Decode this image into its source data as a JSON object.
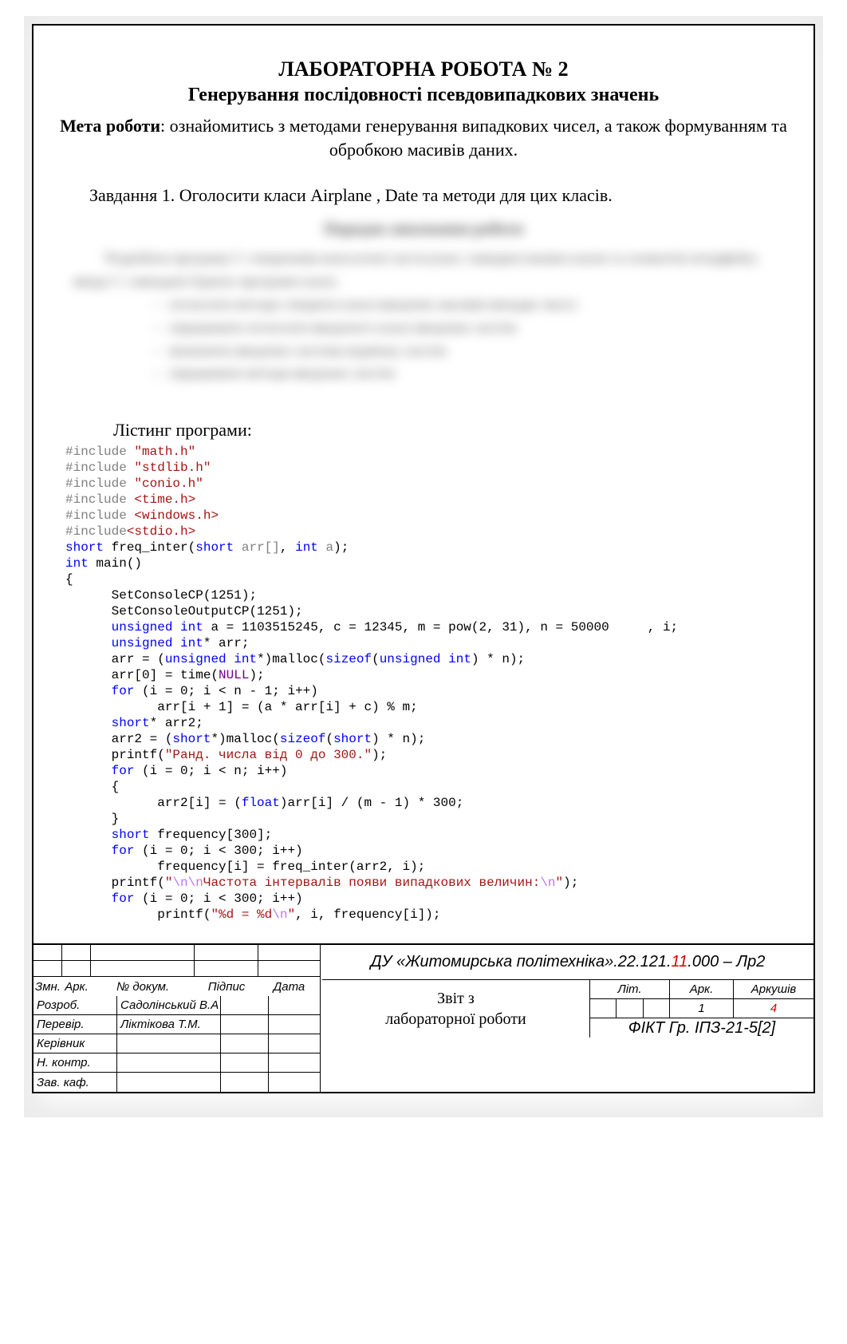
{
  "heading": {
    "title": "ЛАБОРАТОРНА РОБОТА № 2",
    "subtitle": "Генерування послідовності псевдовипадкових значень",
    "objective_label": "Мета роботи",
    "objective_text": ": ознайомитись з методами генерування випадкових чисел, а також формуванням та обробкою масивів даних."
  },
  "task1": "Завдання 1. Оголосити класи Airplane , Date та методи для цих класів.",
  "listing_label": "Лістинг програми:",
  "code": {
    "inc1": "\"math.h\"",
    "inc2": "\"stdlib.h\"",
    "inc3": "\"conio.h\"",
    "inc4": "<time.h>",
    "inc5": "<windows.h>",
    "inc6": "<stdio.h>",
    "fn_decl_name": "freq_inter",
    "setcp": "SetConsoleCP(1251);",
    "setocp": "SetConsoleOutputCP(1251);",
    "vars": "a = 1103515245, c = 12345, m = pow(2, 31), n = 50000     , i;",
    "arr0": "arr[0] = time(",
    "null": "NULL",
    "loop1": "(i = 0; i < n - 1; i++)",
    "loop1_body": "arr[i + 1] = (a * arr[i] + c) % m;",
    "arr2_decl": "* arr2;",
    "arr2_alloc": "arr2 = (",
    "printf1": "\"Ранд. числа від 0 до 300.\"",
    "loop2": "(i = 0; i < n; i++)",
    "loop2_body": "arr2[i] = (",
    "loop2_body2": ")arr[i] / (m - 1) * 300;",
    "freq_decl": " frequency[300];",
    "loop3": "(i = 0; i < 300; i++)",
    "loop3_body": "frequency[i] = freq_inter(arr2, i);",
    "printf2a": "\"",
    "printf2b": "Частота інтервалів появи випадкових величин:",
    "printf2c": "\"",
    "loop4": "(i = 0; i < 300; i++)",
    "printf3": "\"%d = %d",
    "printf3b": "\"",
    "printf3_args": ", i, frequency[i]);"
  },
  "stamp": {
    "headers": {
      "zmn": "Змн.",
      "ark": "Арк.",
      "docnum": "№ докум.",
      "sign": "Підпис",
      "date": "Дата"
    },
    "roles": {
      "dev": "Розроб.",
      "dev_name": "Садолінський В.А",
      "check": "Перевір.",
      "check_name": "Ліктікова Т.М.",
      "lead": "Керівник",
      "nctrl": "Н. контр.",
      "head": "Зав. каф."
    },
    "doc_code_prefix": "ДУ «Житомирська політехніка».22.121.",
    "doc_code_red": "11",
    "doc_code_suffix": ".000 – Лр2",
    "report_title": "Звіт з\nлабораторної роботи",
    "info": {
      "lit": "Літ.",
      "ark": "Арк.",
      "arksh": "Аркушів",
      "ark_val": "1",
      "arksh_val": "4"
    },
    "group": "ФІКТ Гр. ІПЗ-21-5[2]"
  }
}
